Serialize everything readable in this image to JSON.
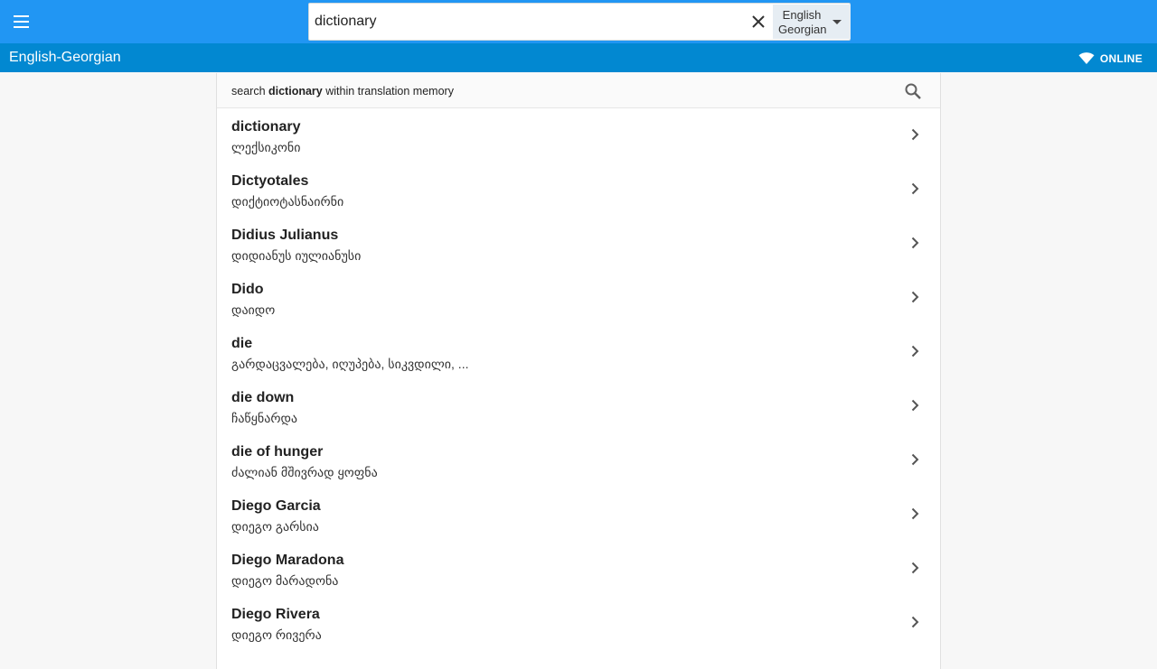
{
  "header": {
    "menu_icon": "hamburger-menu-icon",
    "search": {
      "value": "dictionary",
      "clear_icon": "close-icon"
    },
    "language_selector": {
      "line1": "English",
      "line2": "Georgian",
      "icon": "caret-down-icon"
    }
  },
  "subheader": {
    "title": "English-Georgian",
    "status": {
      "label": "ONLINE",
      "icon": "wifi-icon"
    }
  },
  "tm_search": {
    "prefix": "search ",
    "term": "dictionary",
    "suffix": " within translation memory",
    "icon": "search-icon"
  },
  "results": [
    {
      "term": "dictionary",
      "translation": "ლექსიკონი"
    },
    {
      "term": "Dictyotales",
      "translation": "დიქტიოტასნაირნი"
    },
    {
      "term": "Didius Julianus",
      "translation": "დიდიანუს იულიანუსი"
    },
    {
      "term": "Dido",
      "translation": "დაიდო"
    },
    {
      "term": "die",
      "translation": "გარდაცვალება, იღუპება, სიკვდილი, ..."
    },
    {
      "term": "die down",
      "translation": "ჩაწყნარდა"
    },
    {
      "term": "die of hunger",
      "translation": "ძალიან მშივრად ყოფნა"
    },
    {
      "term": "Diego Garcia",
      "translation": "დიეგო გარსია"
    },
    {
      "term": "Diego Maradona",
      "translation": "დიეგო მარადონა"
    },
    {
      "term": "Diego Rivera",
      "translation": "დიეგო რივერა"
    }
  ],
  "colors": {
    "topbar": "#2196f3",
    "subbar": "#0288d1"
  }
}
